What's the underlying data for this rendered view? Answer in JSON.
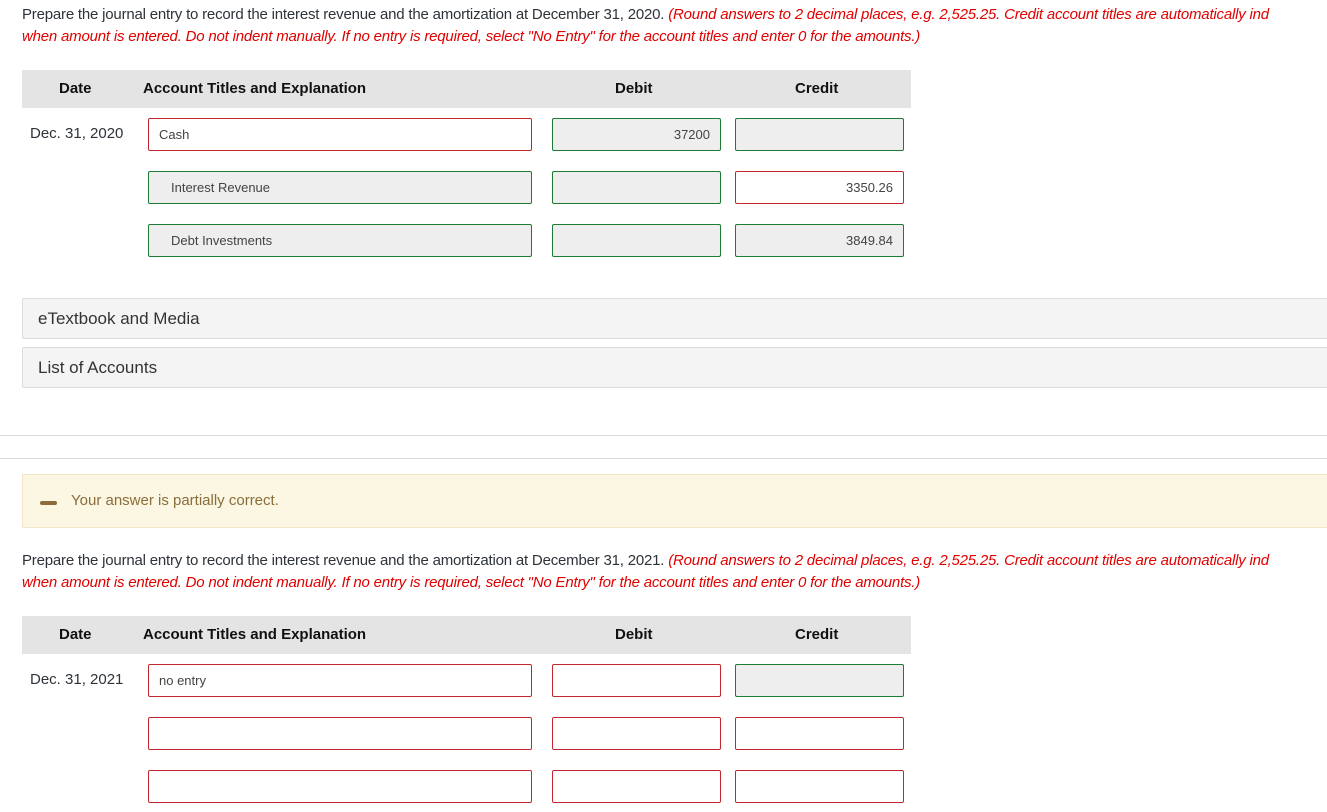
{
  "part1": {
    "instruction_text": "Prepare the journal entry to record the interest revenue and the amortization at December 31, 2020.",
    "instruction_note_line1": "(Round answers to 2 decimal places, e.g. 2,525.25. Credit account titles are automatically ind",
    "instruction_note_line2": "when amount is entered. Do not indent manually. If no entry is required, select \"No Entry\" for the account titles and enter 0 for the amounts.)",
    "headers": {
      "date": "Date",
      "account": "Account Titles and Explanation",
      "debit": "Debit",
      "credit": "Credit"
    },
    "date": "Dec. 31, 2020",
    "rows": [
      {
        "account": "Cash",
        "account_status": "incorrect",
        "debit": "37200",
        "debit_status": "correct",
        "credit": "",
        "credit_status": "correct"
      },
      {
        "account": "Interest Revenue",
        "account_status": "correct",
        "debit": "",
        "debit_status": "correct",
        "credit": "3350.26",
        "credit_status": "incorrect"
      },
      {
        "account": "Debt Investments",
        "account_status": "correct",
        "debit": "",
        "debit_status": "correct",
        "credit": "3849.84",
        "credit_status": "correct"
      }
    ]
  },
  "links": {
    "etextbook": "eTextbook and Media",
    "list_of_accounts": "List of Accounts"
  },
  "feedback": {
    "icon": "minus-icon",
    "message": "Your answer is partially correct.",
    "color": "#8a6d3b"
  },
  "part2": {
    "instruction_text": "Prepare the journal entry to record the interest revenue and the amortization at December 31, 2021.",
    "instruction_note_line1": "(Round answers to 2 decimal places, e.g. 2,525.25. Credit account titles are automatically ind",
    "instruction_note_line2": "when amount is entered. Do not indent manually. If no entry is required, select \"No Entry\" for the account titles and enter 0 for the amounts.)",
    "headers": {
      "date": "Date",
      "account": "Account Titles and Explanation",
      "debit": "Debit",
      "credit": "Credit"
    },
    "date": "Dec. 31, 2021",
    "rows": [
      {
        "account": "no entry",
        "account_status": "incorrect",
        "debit": "",
        "debit_status": "incorrect",
        "credit": "",
        "credit_status": "correct"
      },
      {
        "account": "",
        "account_status": "incorrect",
        "debit": "",
        "debit_status": "incorrect",
        "credit": "",
        "credit_status": "incorrect"
      },
      {
        "account": "",
        "account_status": "incorrect",
        "debit": "",
        "debit_status": "incorrect",
        "credit": "",
        "credit_status": "incorrect"
      }
    ]
  },
  "colors": {
    "correct_border": "#1e7a34",
    "incorrect_border": "#c0282d",
    "instruction_note": "#e00000"
  }
}
